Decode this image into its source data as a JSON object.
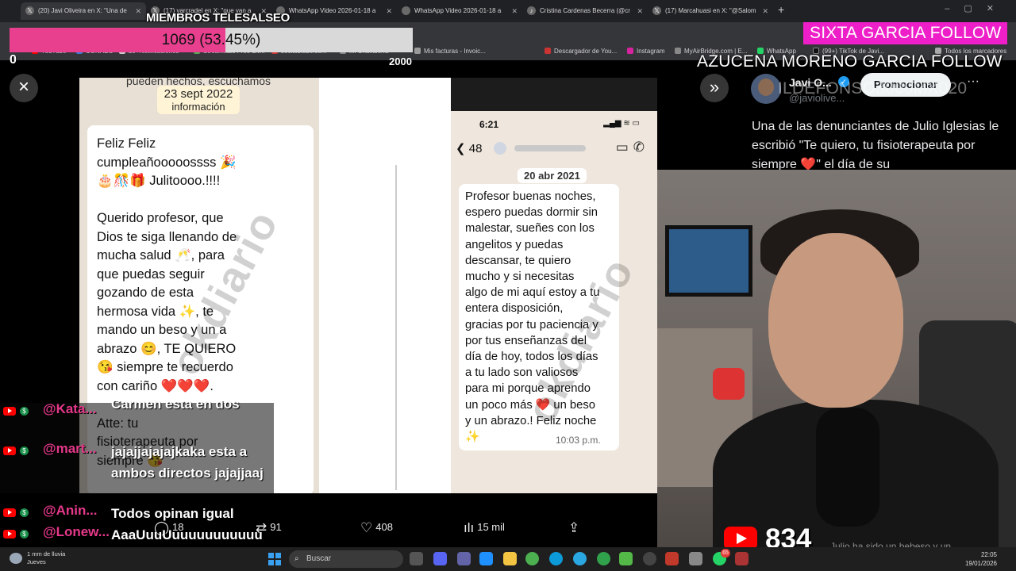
{
  "browser": {
    "tabs": [
      "(20) Javi Oliveira en X: \"Una de",
      "(17) varcradel en X: \"que van a",
      "WhatsApp Video 2026-01-18 a",
      "WhatsApp Video 2026-01-18 a",
      "Cristina Cardenas Becerra (@cr",
      "(17) Marcahuasi en X: \"@Salom"
    ],
    "new_tab": "+",
    "bookmarks": [
      "YouTube",
      "CONAEO",
      "20+Notificaciones",
      "Streamlabs Free Liv...",
      "socialblade.com",
      "Mi Chavalería",
      "Mis facturas - Invoic...",
      "Descargador de You...",
      "Instagram",
      "MyAirBridge.com | E...",
      "WhatsApp",
      "(99+) TikTok de Javi...",
      "Todos los marcadores"
    ]
  },
  "overlay": {
    "members_title": "MIEMBROS TELESALSEO",
    "members_progress_text": "1069 (53.45%)",
    "members_progress_fraction": 0.5345,
    "members_min": "0",
    "members_max": "2000",
    "follow_1": "SIXTA GARCIA  FOLLOW",
    "follow_2": "AZUCENA MORENO GARCIA  FOLLOW",
    "follow_3": "ILDEFONSO3000MX020"
  },
  "viewer": {
    "close_label": "×",
    "next_label": "»",
    "left_image": {
      "date_line_1": "23 sept 2022",
      "date_line_2": "información",
      "partial_header": "pueden hechos, escuchamos",
      "message": "Feliz Feliz\ncumpleañooooossss 🎉\n🎂🎊🎁 Julitoooo.!!!!\n\nQuerido profesor, que\nDios te siga llenando de\nmucha salud 🥂, para\nque puedas seguir\ngozando de esta\nhermosa vida ✨, te\nmando un beso y un a\nabrazo 😊, TE QUIERO\n😘 siempre te recuerdo\ncon cariño ❤️❤️❤️.\n\nAtte: tu\nfisioterapeuta por\nsiempre 😘",
      "watermark": "okdiario"
    },
    "right_image": {
      "status_time": "6:21",
      "back_count": "48",
      "date": "20 abr 2021",
      "message": "Profesor buenas noches,\nespero puedas dormir sin\nmalestar, sueñes con los\nangelitos y puedas\ndescansar, te quiero\nmucho y si necesitas\nalgo de mi aquí estoy a tu\nentera disposición,\ngracias por tu paciencia y\npor tus enseñanzas del\ndía de hoy, todos los días\na tu lado son valiosos\npara mi porque aprendo\nun poco más ❤️ un beso\ny un abrazo.! Feliz noche\n✨",
      "time": "10:03 p.m.",
      "watermark": "okdiario"
    },
    "tweet_actions": {
      "replies": "18",
      "reposts": "91",
      "likes": "408",
      "views": "15 mil"
    }
  },
  "tweet_panel": {
    "name": "Javi O...",
    "handle": "@javiolive...",
    "promote_label": "Promocionar",
    "more_label": "···",
    "text": "Una de las denunciantes de Julio Iglesias le escribió \"Te quiero, tu fisioterapeuta por siempre ❤️\" el día de su"
  },
  "stream": {
    "viewer_count": "834",
    "caption": "Julio ha sido un bebeso y un"
  },
  "chat": [
    {
      "user": "@Kata...",
      "msg": "Carmen esta en dos directos a la vez"
    },
    {
      "user": "@mart...",
      "msg": "jajajjajajajkaka esta a ambos directos jajajjaaj"
    },
    {
      "user": "@Anin...",
      "msg": "Todos opinan igual"
    },
    {
      "user": "@Lonew...",
      "msg": "AaaUuuUuuuuuuuuuuuu"
    }
  ],
  "taskbar": {
    "weather_line_1": "1 mm de lluvia",
    "weather_line_2": "Jueves",
    "search_placeholder": "Buscar",
    "time": "22:05",
    "date": "19/01/2026",
    "notification_badge": "65"
  }
}
